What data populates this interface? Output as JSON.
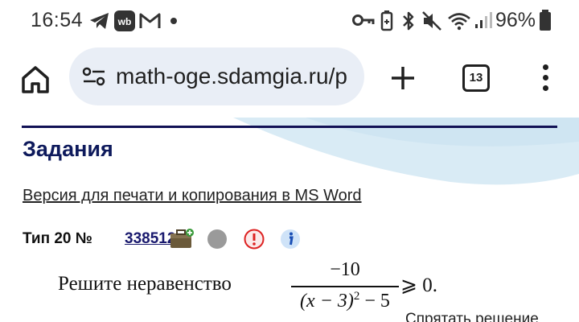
{
  "status_bar": {
    "time": "16:54",
    "battery": "96%",
    "icons": [
      "telegram-icon",
      "wb-icon",
      "gmail-icon",
      "dot-icon",
      "key-icon",
      "battery-saver-icon",
      "bluetooth-icon",
      "mute-icon",
      "wifi-icon",
      "signal-icon",
      "battery-icon"
    ],
    "wb_label": "wb"
  },
  "browser": {
    "url": "math-oge.sdamgia.ru/p",
    "tab_count": "13"
  },
  "page": {
    "heading": "Задания",
    "print_link": "Версия для печати и копирования в MS Word",
    "task_type": "Тип 20 №",
    "task_id": "338512",
    "problem": {
      "text": "Решите неравенство",
      "numerator": "−10",
      "denominator_left": "(x − 3)",
      "denominator_exp": "2",
      "denominator_right": " − 5",
      "relation": "⩾ 0."
    },
    "hide_solution": "Спрятать решение"
  },
  "colors": {
    "heading": "#0e1a5c",
    "link": "#1a1a6e",
    "url_bar": "#e9eef6",
    "wave": "#d9ebf5"
  }
}
